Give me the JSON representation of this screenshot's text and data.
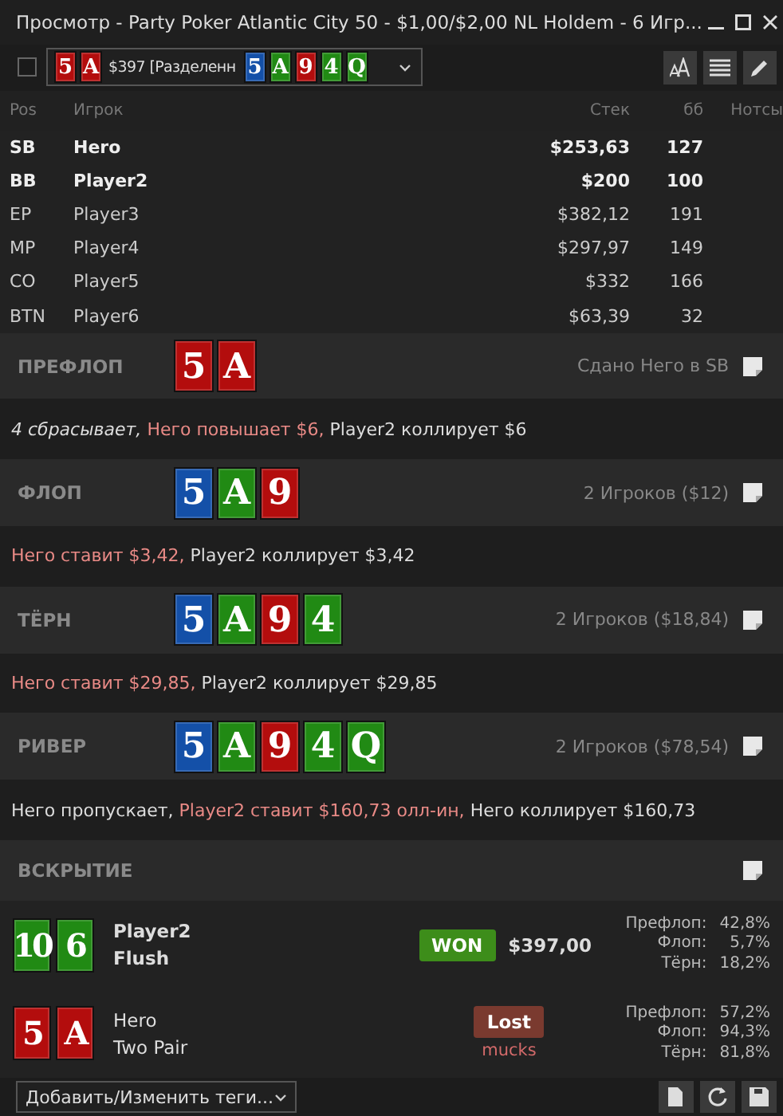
{
  "window": {
    "title": "Просмотр - Party Poker Atlantic City 50 - $1,00/$2,00 NL Holdem - 6 Игр..."
  },
  "toolbar": {
    "checked": false,
    "hand_selector": {
      "hole_cards": [
        {
          "rank": "5",
          "color": "#b30d0d"
        },
        {
          "rank": "A",
          "color": "#b30d0d"
        }
      ],
      "text": "$397 [Разделенн",
      "board": [
        {
          "rank": "5",
          "color": "#1450a8"
        },
        {
          "rank": "A",
          "color": "#218a14"
        },
        {
          "rank": "9",
          "color": "#b30d0d"
        },
        {
          "rank": "4",
          "color": "#218a14"
        },
        {
          "rank": "Q",
          "color": "#218a14"
        }
      ]
    }
  },
  "table": {
    "columns": [
      "Pos",
      "Игрок",
      "Стек",
      "бб",
      "Нотсы"
    ],
    "rows": [
      {
        "pos": "SB",
        "player": "Hero",
        "stack": "$253,63",
        "bb": "127",
        "bold": true
      },
      {
        "pos": "BB",
        "player": "Player2",
        "stack": "$200",
        "bb": "100",
        "bold": true
      },
      {
        "pos": "EP",
        "player": "Player3",
        "stack": "$382,12",
        "bb": "191",
        "bold": false
      },
      {
        "pos": "MP",
        "player": "Player4",
        "stack": "$297,97",
        "bb": "149",
        "bold": false
      },
      {
        "pos": "CO",
        "player": "Player5",
        "stack": "$332",
        "bb": "166",
        "bold": false
      },
      {
        "pos": "BTN",
        "player": "Player6",
        "stack": "$63,39",
        "bb": "32",
        "bold": false
      }
    ]
  },
  "streets": [
    {
      "name": "ПРЕФЛОП",
      "cards": [
        {
          "rank": "5",
          "color": "#b30d0d"
        },
        {
          "rank": "A",
          "color": "#b30d0d"
        }
      ],
      "summary": "Сдано Него в SB",
      "actions": [
        {
          "text": "4 сбрасывает, ",
          "kind": "fold"
        },
        {
          "text": "Него повышает $6, ",
          "kind": "aggressive"
        },
        {
          "text": "Player2 коллирует $6",
          "kind": "passive"
        }
      ]
    },
    {
      "name": "ФЛОП",
      "cards": [
        {
          "rank": "5",
          "color": "#1450a8"
        },
        {
          "rank": "A",
          "color": "#218a14"
        },
        {
          "rank": "9",
          "color": "#b30d0d"
        }
      ],
      "summary": "2 Игроков ($12)",
      "actions": [
        {
          "text": "Него ставит $3,42, ",
          "kind": "aggressive"
        },
        {
          "text": "Player2 коллирует $3,42",
          "kind": "passive"
        }
      ]
    },
    {
      "name": "ТЁРН",
      "cards": [
        {
          "rank": "5",
          "color": "#1450a8"
        },
        {
          "rank": "A",
          "color": "#218a14"
        },
        {
          "rank": "9",
          "color": "#b30d0d"
        },
        {
          "rank": "4",
          "color": "#218a14"
        }
      ],
      "summary": "2 Игроков ($18,84)",
      "actions": [
        {
          "text": "Него ставит $29,85, ",
          "kind": "aggressive"
        },
        {
          "text": "Player2 коллирует $29,85",
          "kind": "passive"
        }
      ]
    },
    {
      "name": "РИВЕР",
      "cards": [
        {
          "rank": "5",
          "color": "#1450a8"
        },
        {
          "rank": "A",
          "color": "#218a14"
        },
        {
          "rank": "9",
          "color": "#b30d0d"
        },
        {
          "rank": "4",
          "color": "#218a14"
        },
        {
          "rank": "Q",
          "color": "#218a14"
        }
      ],
      "summary": "2 Игроков ($78,54)",
      "actions": [
        {
          "text": "Него пропускает, ",
          "kind": "passive"
        },
        {
          "text": "Player2 ставит $160,73 олл-ин, ",
          "kind": "aggressive"
        },
        {
          "text": "Него коллирует $160,73",
          "kind": "passive"
        }
      ]
    }
  ],
  "showdown": {
    "title": "ВСКРЫТИЕ",
    "players": [
      {
        "cards": [
          {
            "rank": "10",
            "color": "#218a14"
          },
          {
            "rank": "6",
            "color": "#218a14"
          }
        ],
        "name": "Player2",
        "hand": "Flush",
        "winner": true,
        "result": "WON",
        "amount": "$397,00",
        "equity": [
          {
            "label": "Префлоп:",
            "value": "42,8%"
          },
          {
            "label": "Флоп:",
            "value": "5,7%"
          },
          {
            "label": "Тёрн:",
            "value": "18,2%"
          }
        ]
      },
      {
        "cards": [
          {
            "rank": "5",
            "color": "#b30d0d"
          },
          {
            "rank": "A",
            "color": "#b30d0d"
          }
        ],
        "name": "Hero",
        "hand": "Two Pair",
        "winner": false,
        "result": "Lost",
        "note": "mucks",
        "equity": [
          {
            "label": "Префлоп:",
            "value": "57,2%"
          },
          {
            "label": "Флоп:",
            "value": "94,3%"
          },
          {
            "label": "Тёрн:",
            "value": "81,8%"
          }
        ]
      }
    ]
  },
  "footer": {
    "tags": "Добавить/Изменить теги..."
  }
}
